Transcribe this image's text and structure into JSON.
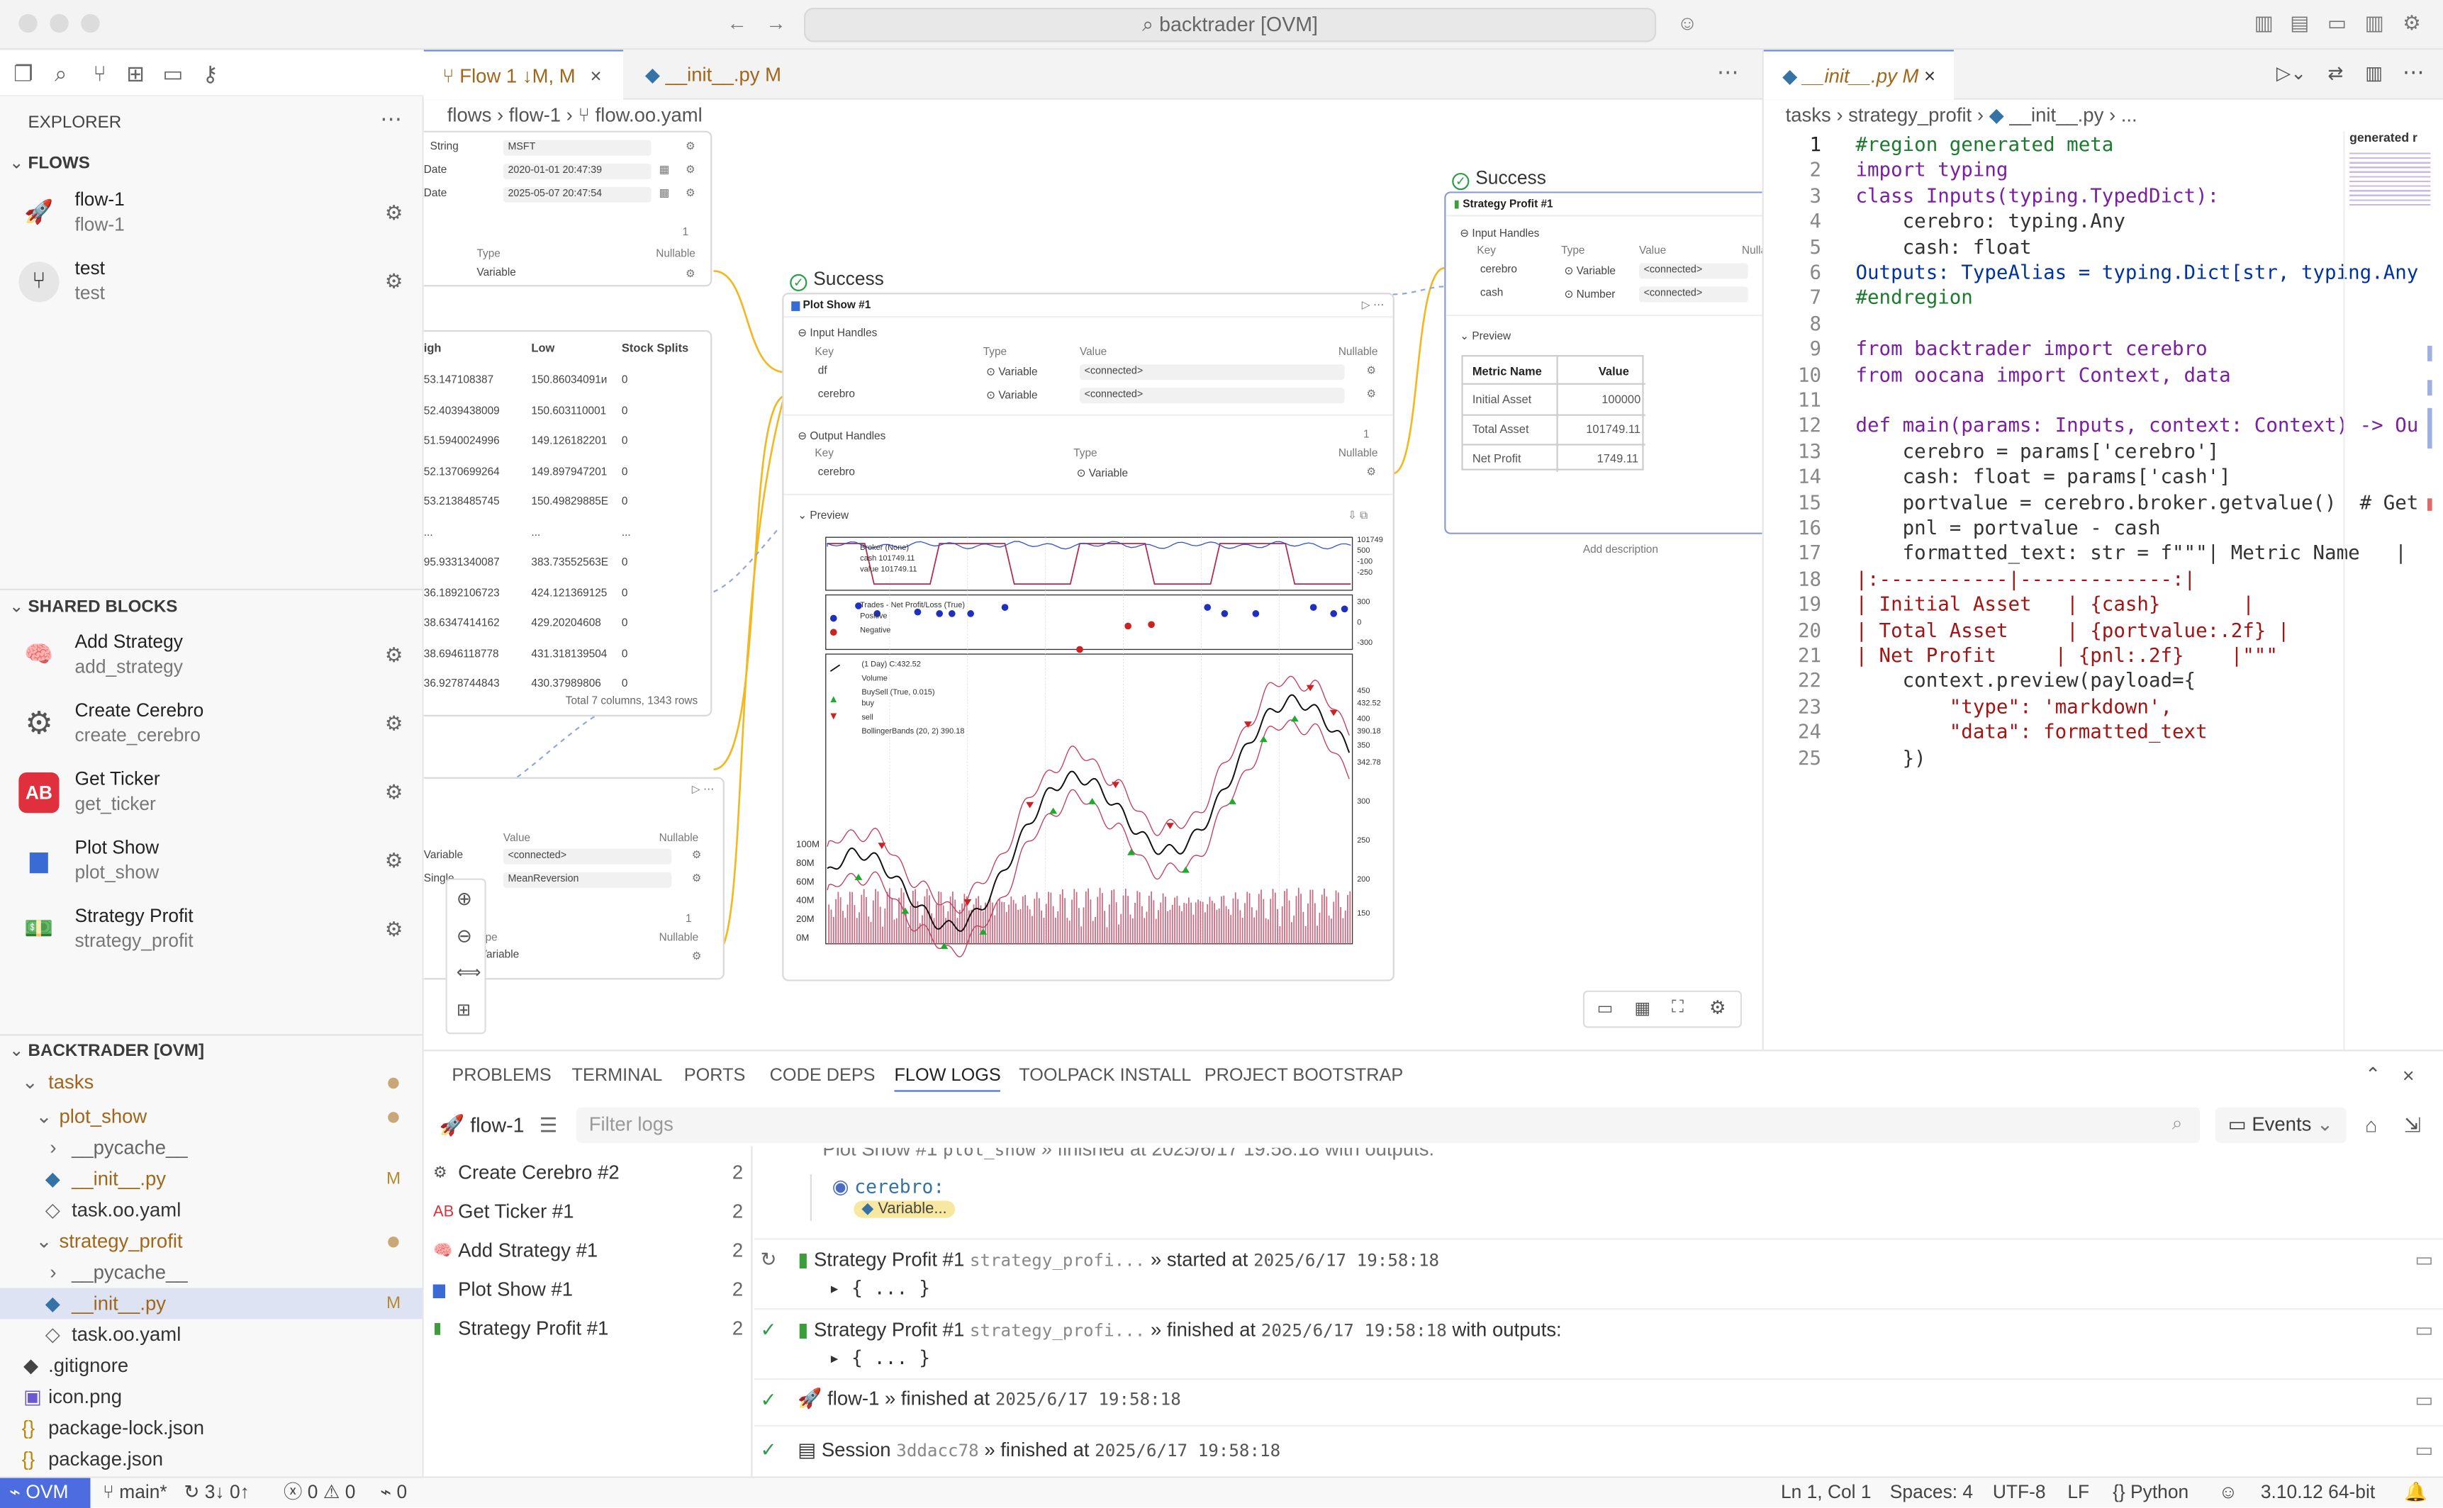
{
  "window": {
    "title": "backtrader [OVM]"
  },
  "explorer": {
    "header": "EXPLORER",
    "flows_header": "FLOWS",
    "flows": [
      {
        "name": "flow-1",
        "sub": "flow-1"
      },
      {
        "name": "test",
        "sub": "test"
      }
    ],
    "shared_header": "SHARED BLOCKS",
    "blocks": [
      {
        "name": "Add Strategy",
        "sub": "add_strategy"
      },
      {
        "name": "Create Cerebro",
        "sub": "create_cerebro"
      },
      {
        "name": "Get Ticker",
        "sub": "get_ticker"
      },
      {
        "name": "Plot Show",
        "sub": "plot_show"
      },
      {
        "name": "Strategy Profit",
        "sub": "strategy_profit"
      }
    ],
    "workspace_header": "BACKTRADER [OVM]",
    "tree": [
      "tasks",
      "plot_show",
      "__pycache__",
      "__init__.py",
      "task.oo.yaml",
      "strategy_profit",
      "__pycache__",
      "__init__.py",
      "task.oo.yaml",
      ".gitignore",
      "icon.png",
      "package-lock.json",
      "package.json"
    ],
    "modified": "M"
  },
  "editor_left": {
    "tabs": [
      {
        "label": "Flow 1",
        "badge": "↓M, M"
      },
      {
        "label": "__init__.py",
        "badge": "M"
      }
    ],
    "breadcrumb": [
      "flows",
      "flow-1",
      "flow.oo.yaml"
    ]
  },
  "canvas": {
    "left_node": {
      "string_label": "String",
      "string_val": "MSFT",
      "date1_label": "Date",
      "date1_val": "2020-01-01 20:47:39",
      "date2_label": "Date",
      "date2_val": "2025-05-07 20:47:54",
      "type_h": "Type",
      "nullable_h": "Nullable",
      "variable": "Variable",
      "count": "1"
    },
    "table": {
      "headers": [
        "igh",
        "Low",
        "Stock Splits"
      ],
      "rows": [
        [
          "53.147108387",
          "150.86034091и",
          "0"
        ],
        [
          "52.4039438009",
          "150.603110001",
          "0"
        ],
        [
          "51.5940024996",
          "149.126182201",
          "0"
        ],
        [
          "52.1370699264",
          "149.897947201",
          "0"
        ],
        [
          "53.2138485745",
          "150.49829885Е",
          "0"
        ],
        [
          "...",
          "...",
          "..."
        ],
        [
          "95.9331340087",
          "383.73552563Е",
          "0"
        ],
        [
          "36.1892106723",
          "424.121369125",
          "0"
        ],
        [
          "38.6347414162",
          "429.20204608",
          "0"
        ],
        [
          "38.6946118778",
          "431.318139504",
          "0"
        ],
        [
          "36.9278744843",
          "430.37989806",
          "0"
        ]
      ],
      "footer": "Total 7 columns, 1343 rows"
    },
    "lower_node": {
      "value_h": "Value",
      "nullable_h": "Nullable",
      "variable": "Variable",
      "connected": "<connected>",
      "single": "Single",
      "strategy": "MeanReversion",
      "count": "1",
      "type_h": "ype"
    },
    "plot_status": "Success",
    "plot_node": {
      "title": "Plot Show #1",
      "input_handles": "Input Handles",
      "key_h": "Key",
      "type_h": "Type",
      "value_h": "Value",
      "nullable_h": "Nullable",
      "in_rows": [
        {
          "k": "df",
          "t": "Variable",
          "v": "<connected>"
        },
        {
          "k": "cerebro",
          "t": "Variable",
          "v": "<connected>"
        }
      ],
      "output_handles": "Output Handles",
      "out_rows": [
        {
          "k": "cerebro",
          "t": "Variable"
        }
      ],
      "preview": "Preview",
      "count": "1"
    },
    "chart_labels": {
      "broker": "Broker (None)",
      "cash": "cash 101749.11",
      "value": "value 101749.11",
      "trades": "Trades - Net Profit/Loss (True)",
      "positive": "Positive",
      "negative": "Negative",
      "price": "(1 Day) C:432.52",
      "volume": "Volume",
      "buysell": "BuySell (True, 0.015)",
      "buy": "buy",
      "sell": "sell",
      "bb": "BollingerBands (20, 2) 390.18",
      "right_ticks": [
        "101749",
        "500",
        "-100",
        "-250",
        "300",
        "0",
        "-300",
        "450",
        "432.52",
        "400",
        "390.18",
        "350",
        "342.78",
        "300",
        "250",
        "200",
        "150"
      ],
      "vol_ticks": [
        "100M",
        "80M",
        "60M",
        "40M",
        "20M",
        "0M"
      ]
    },
    "profit_status": "Success",
    "profit_node": {
      "title": "Strategy Profit #1",
      "input_handles": "Input Handles",
      "key_h": "Key",
      "type_h": "Type",
      "value_h": "Value",
      "nullable_h": "Nullab",
      "rows": [
        {
          "k": "cerebro",
          "t": "Variable",
          "v": "<connected>"
        },
        {
          "k": "cash",
          "t": "Number",
          "v": "<connected>"
        }
      ],
      "preview": "Preview",
      "metric_h": "Metric Name",
      "value_col": "Value",
      "metrics": [
        {
          "n": "Initial Asset",
          "v": "100000"
        },
        {
          "n": "Total Asset",
          "v": "101749.11"
        },
        {
          "n": "Net Profit",
          "v": "1749.11"
        }
      ],
      "add_desc": "Add description"
    }
  },
  "editor_right": {
    "tab": {
      "label": "__init__.py",
      "badge": "M"
    },
    "breadcrumb": [
      "tasks",
      "strategy_profit",
      "__init__.py",
      "..."
    ]
  },
  "code_lines": [
    "#region generated meta",
    "import typing",
    "class Inputs(typing.TypedDict):",
    "    cerebro: typing.Any",
    "    cash: float",
    "Outputs: TypeAlias = typing.Dict[str, typing.Any",
    "#endregion",
    "",
    "from backtrader import cerebro",
    "from oocana import Context, data",
    "",
    "def main(params: Inputs, context: Context) -> Ou",
    "    cerebro = params['cerebro']",
    "    cash: float = params['cash']",
    "    portvalue = cerebro.broker.getvalue()  # Get",
    "    pnl = portvalue - cash",
    "    formatted_text: str = f\"\"\"| Metric Name   |",
    "|:-----------|-------------:|",
    "| Initial Asset   | {cash}       |",
    "| Total Asset     | {portvalue:.2f} |",
    "| Net Profit     | {pnl:.2f}    |\"\"\"",
    "    context.preview(payload={",
    "        \"type\": 'markdown',",
    "        \"data\": formatted_text",
    "    })"
  ],
  "minimap_label": "generated r",
  "panel": {
    "tabs": [
      "PROBLEMS",
      "TERMINAL",
      "PORTS",
      "CODE DEPS",
      "FLOW LOGS",
      "TOOLPACK INSTALL",
      "PROJECT BOOTSTRAP"
    ],
    "active": "FLOW LOGS",
    "flow_select": "flow-1",
    "filter_placeholder": "Filter logs",
    "events": "Events",
    "blocks": [
      {
        "n": "Create Cerebro #2",
        "c": "2"
      },
      {
        "n": "Get Ticker #1",
        "c": "2"
      },
      {
        "n": "Add Strategy #1",
        "c": "2"
      },
      {
        "n": "Plot Show #1",
        "c": "2"
      },
      {
        "n": "Strategy Profit #1",
        "c": "2"
      }
    ],
    "events_list": [
      {
        "t": "Plot Show #1",
        "id": "plot_show",
        "a": "finished at",
        "d": "2025/6/17 19:58:18",
        "e": "with outputs:"
      },
      {
        "t": "cerebro:",
        "id": "",
        "a": "Variable...",
        "d": "",
        "e": ""
      },
      {
        "t": "Strategy Profit #1",
        "id": "strategy_profi...",
        "a": "started at",
        "d": "2025/6/17 19:58:18",
        "e": ""
      },
      {
        "t": "{ ... }",
        "id": "",
        "a": "",
        "d": "",
        "e": ""
      },
      {
        "t": "Strategy Profit #1",
        "id": "strategy_profi...",
        "a": "finished at",
        "d": "2025/6/17 19:58:18",
        "e": "with outputs:"
      },
      {
        "t": "{ ... }",
        "id": "",
        "a": "",
        "d": "",
        "e": ""
      },
      {
        "t": "flow-1",
        "id": "",
        "a": "finished at",
        "d": "2025/6/17 19:58:18",
        "e": ""
      },
      {
        "t": "Session",
        "id": "3ddacc78",
        "a": "finished at",
        "d": "2025/6/17 19:58:18",
        "e": ""
      }
    ]
  },
  "status": {
    "remote": "OVM",
    "branch": "main*",
    "sync": "3↓ 0↑",
    "errors": "0",
    "warnings": "0",
    "ports": "0",
    "position": "Ln 1, Col 1",
    "spaces": "Spaces: 4",
    "encoding": "UTF-8",
    "eol": "LF",
    "lang": "Python",
    "interp": "3.10.12 64-bit"
  }
}
